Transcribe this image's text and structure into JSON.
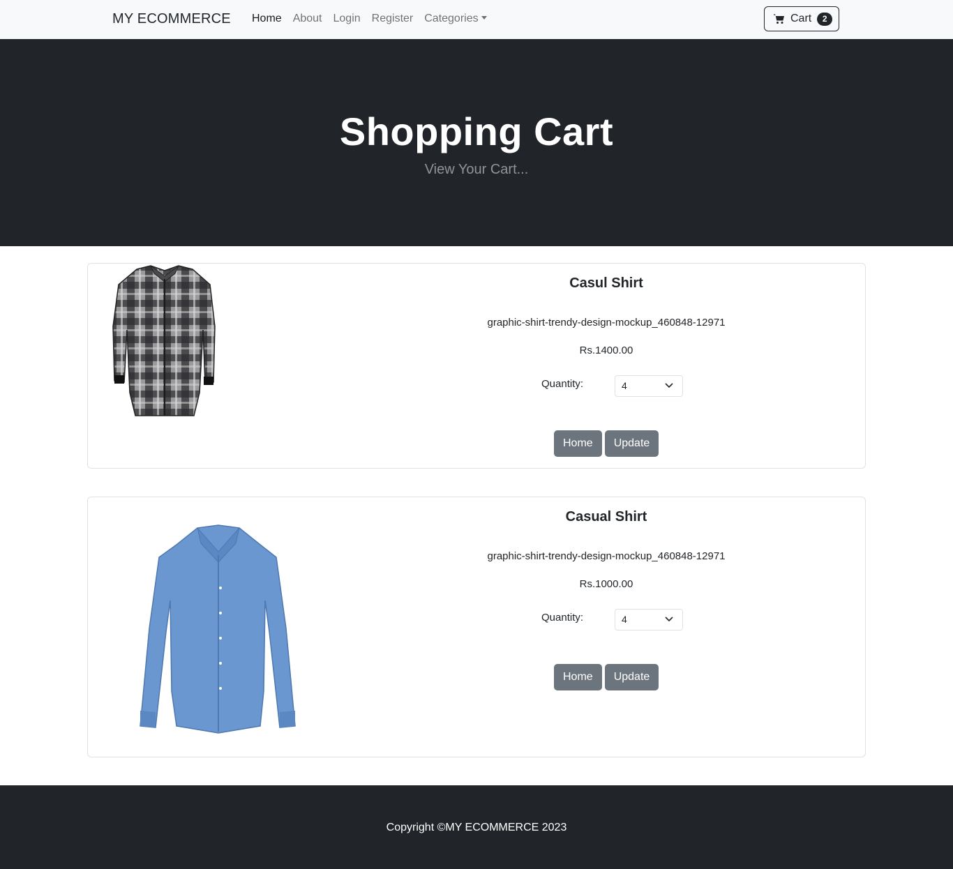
{
  "navbar": {
    "brand": "MY ECOMMERCE",
    "links": [
      {
        "label": "Home"
      },
      {
        "label": "About"
      },
      {
        "label": "Login"
      },
      {
        "label": "Register"
      },
      {
        "label": "Categories"
      }
    ],
    "cart_label": "Cart",
    "cart_count": "2"
  },
  "hero": {
    "title": "Shopping Cart",
    "subtitle": "View Your Cart..."
  },
  "items": [
    {
      "title": "Casul Shirt",
      "description": "graphic-shirt-trendy-design-mockup_460848-12971",
      "price": "Rs.1400.00",
      "quantity_label": "Quantity:",
      "quantity_value": "4",
      "home_label": "Home",
      "update_label": "Update"
    },
    {
      "title": "Casual Shirt",
      "description": "graphic-shirt-trendy-design-mockup_460848-12971",
      "price": "Rs.1000.00",
      "quantity_label": "Quantity:",
      "quantity_value": "4",
      "home_label": "Home",
      "update_label": "Update"
    }
  ],
  "footer": {
    "copyright": "Copyright ©MY ECOMMERCE 2023"
  },
  "colors": {
    "dark": "#212529",
    "light": "#f8f9fa",
    "button": "#6c757d",
    "plaid_shirt": "#5a5a5c",
    "blue_shirt": "#6a97d0"
  }
}
